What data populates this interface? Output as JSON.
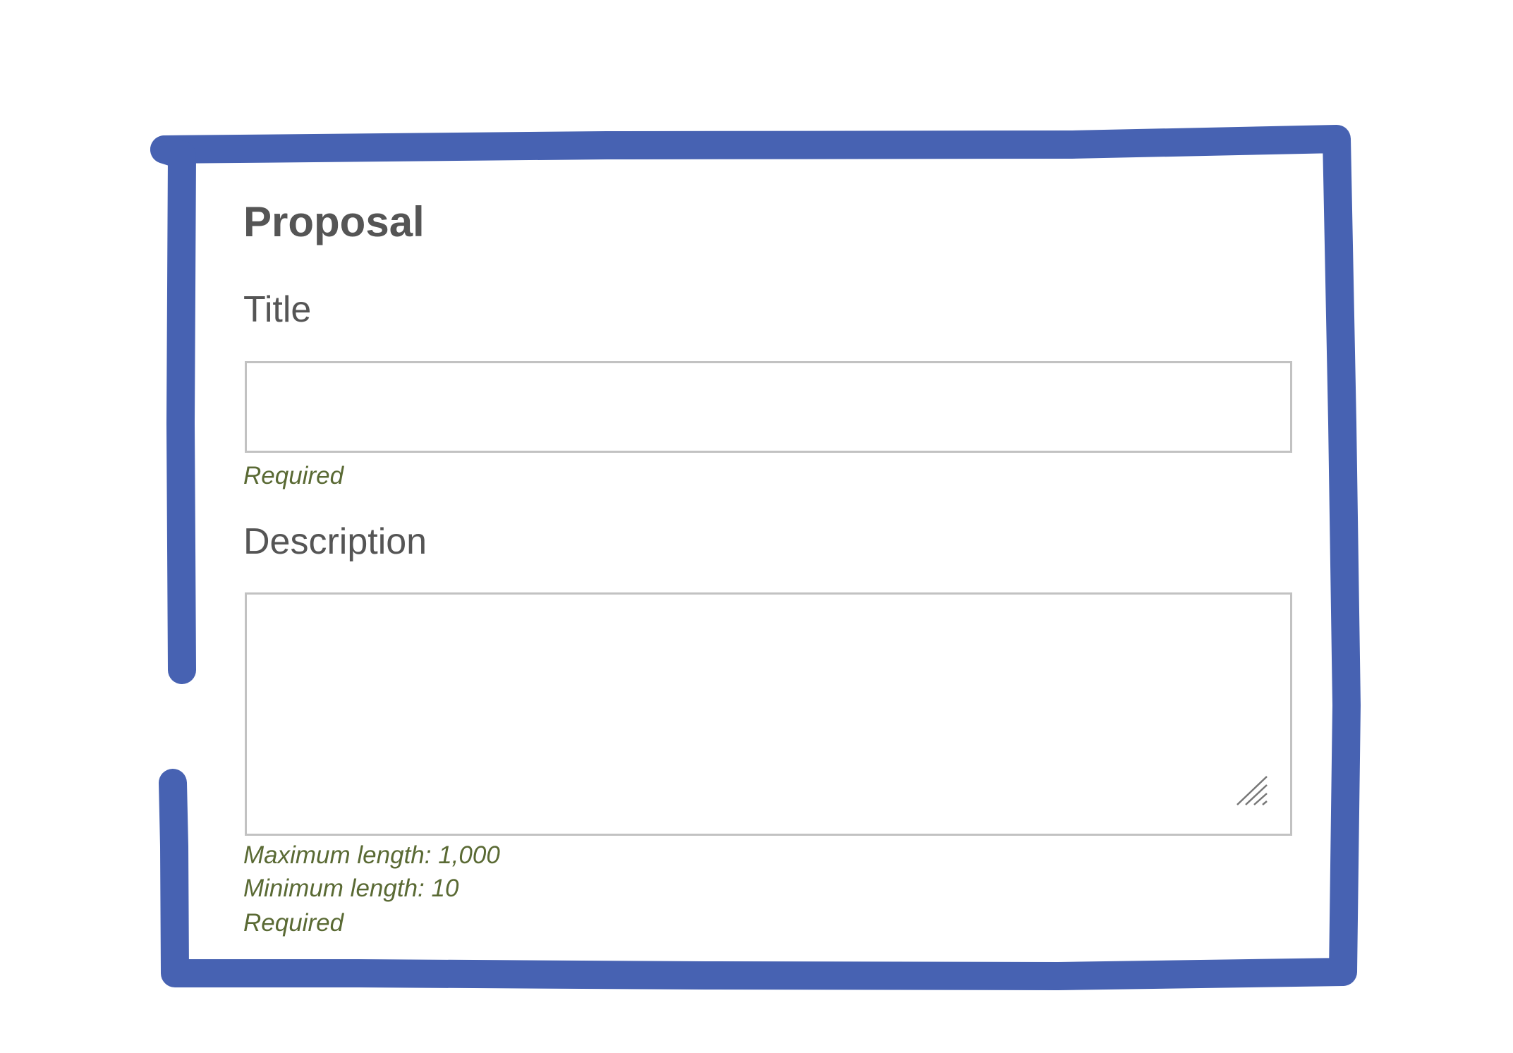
{
  "colors": {
    "frame": "#4762b2",
    "heading": "#555555",
    "label": "#555555",
    "hint": "#5a6a34",
    "input_border": "#c2c2c2"
  },
  "form": {
    "heading": "Proposal",
    "title_field": {
      "label": "Title",
      "value": "",
      "hints": [
        "Required"
      ]
    },
    "description_field": {
      "label": "Description",
      "value": "",
      "hints": [
        "Maximum length: 1,000",
        "Minimum length: 10",
        "Required"
      ]
    }
  },
  "icons": {
    "resize": "resize-grip-icon"
  }
}
